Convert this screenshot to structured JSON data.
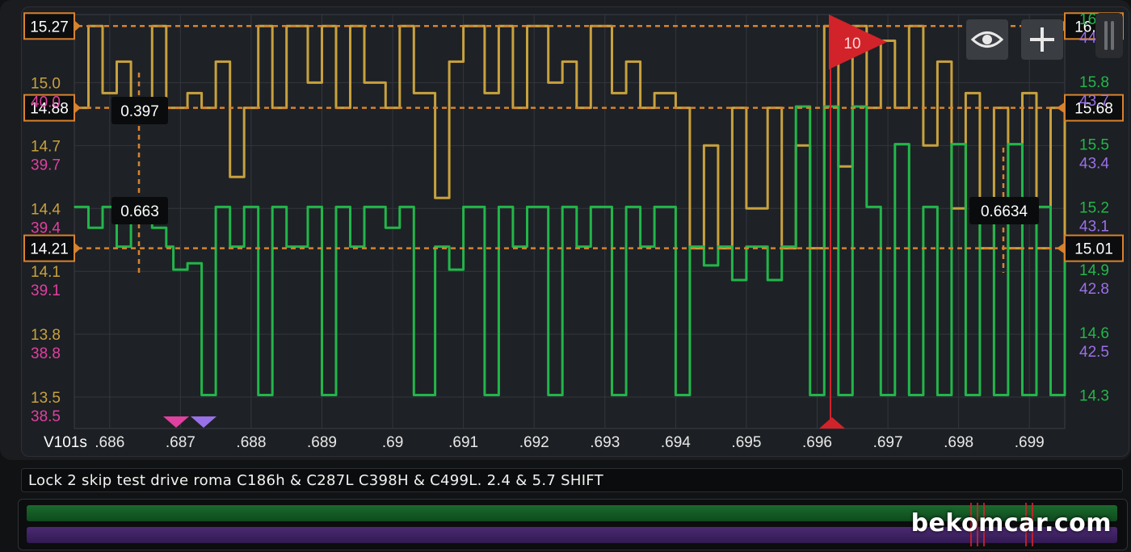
{
  "ranges": {
    "left_primary": {
      "min": 13.35,
      "max": 15.325
    },
    "right_primary": {
      "min": 14.14,
      "max": 16.12
    }
  },
  "left_axis": {
    "gold_ticks": [
      "15.0",
      "14.7",
      "14.4",
      "14.1",
      "13.8",
      "13.5"
    ],
    "pink_ticks": [
      "40.0",
      "39.7",
      "39.4",
      "39.1",
      "38.8",
      "38.5"
    ]
  },
  "right_axis": {
    "green_ticks": [
      "16.1",
      "15.8",
      "15.5",
      "15.2",
      "14.9",
      "14.6",
      "14.3"
    ],
    "purple_ticks": [
      "44.0",
      "43.7",
      "43.4",
      "43.1",
      "42.8",
      "42.5"
    ]
  },
  "x_axis": {
    "label": "V101s",
    "ticks": [
      ".686",
      ".687",
      ".688",
      ".689",
      ".69",
      ".691",
      ".692",
      ".693",
      ".694",
      ".695",
      ".696",
      ".697",
      ".698",
      ".699"
    ]
  },
  "cursor_lines": {
    "left": [
      "15.27",
      "14.88",
      "14.21"
    ],
    "right": [
      "16.07",
      "15.68",
      "15.01"
    ]
  },
  "value_labels": [
    "0.397",
    "0.663",
    "0.6634"
  ],
  "flag": {
    "label": "10"
  },
  "caption": "Lock 2 skip test drive roma C186h & C287L C398H & C499L.  2.4 & 5.7 SHIFT",
  "watermark": "bekomcar.com",
  "tools": {
    "eye_icon": "eye-icon",
    "plus_icon": "plus-icon"
  },
  "colors": {
    "gold": "#c8a13e",
    "green": "#22b64a",
    "pink": "#e040a0",
    "purple": "#9a70e8",
    "cursor": "#d8822e",
    "flag": "#d2232a"
  },
  "chart_data": {
    "type": "line",
    "x_range": [
      0.6855,
      0.6995
    ],
    "series": [
      {
        "color": "gold",
        "x": [
          0.6855,
          0.6857,
          0.6859,
          0.6861,
          0.6863,
          0.6866,
          0.6868,
          0.6871,
          0.6873,
          0.6875,
          0.6877,
          0.6879,
          0.6881,
          0.6883,
          0.6885,
          0.6888,
          0.689,
          0.6892,
          0.6894,
          0.6896,
          0.6899,
          0.6901,
          0.6903,
          0.6906,
          0.6908,
          0.691,
          0.6913,
          0.6915,
          0.6917,
          0.6919,
          0.6922,
          0.6924,
          0.6926,
          0.6928,
          0.6931,
          0.6933,
          0.6935,
          0.6937,
          0.694,
          0.6942,
          0.6944,
          0.6946,
          0.6948,
          0.695,
          0.6953,
          0.6955,
          0.6957,
          0.6959,
          0.6961,
          0.6963,
          0.6965,
          0.6967,
          0.6969,
          0.6971,
          0.6973,
          0.6975,
          0.6977,
          0.6979,
          0.6981,
          0.6983,
          0.6985,
          0.6987,
          0.6989,
          0.6991,
          0.6993,
          0.6995
        ],
        "values": [
          14.88,
          15.27,
          14.95,
          15.1,
          14.88,
          15.27,
          14.88,
          14.95,
          14.88,
          15.1,
          14.55,
          14.88,
          15.27,
          14.88,
          15.27,
          15.0,
          15.27,
          14.88,
          15.27,
          15.0,
          14.88,
          15.27,
          14.95,
          14.45,
          15.1,
          15.27,
          14.95,
          15.27,
          14.88,
          15.27,
          15.0,
          15.1,
          14.88,
          15.27,
          14.95,
          15.1,
          14.88,
          14.95,
          14.88,
          14.21,
          14.7,
          14.21,
          14.88,
          14.4,
          14.88,
          14.21,
          14.7,
          14.21,
          15.27,
          14.6,
          15.27,
          14.88,
          15.2,
          14.88,
          15.27,
          14.7,
          15.1,
          14.4,
          14.95,
          14.21,
          14.88,
          14.21,
          14.95,
          14.21,
          14.88,
          14.21
        ]
      },
      {
        "color": "green",
        "x": [
          0.6855,
          0.6857,
          0.6859,
          0.6861,
          0.6863,
          0.6866,
          0.6868,
          0.6869,
          0.6871,
          0.6873,
          0.6875,
          0.6877,
          0.6879,
          0.6881,
          0.6883,
          0.6885,
          0.6888,
          0.689,
          0.6892,
          0.6894,
          0.6896,
          0.6899,
          0.6901,
          0.6903,
          0.6906,
          0.6908,
          0.691,
          0.6913,
          0.6915,
          0.6917,
          0.6919,
          0.6922,
          0.6924,
          0.6926,
          0.6928,
          0.6931,
          0.6933,
          0.6935,
          0.6937,
          0.694,
          0.6942,
          0.6944,
          0.6946,
          0.6948,
          0.695,
          0.6953,
          0.6955,
          0.6957,
          0.6959,
          0.6961,
          0.6963,
          0.6965,
          0.6967,
          0.6969,
          0.6971,
          0.6973,
          0.6975,
          0.6977,
          0.6979,
          0.6981,
          0.6983,
          0.6985,
          0.6987,
          0.6989,
          0.6991,
          0.6993,
          0.6995
        ],
        "values": [
          15.2,
          15.1,
          15.2,
          15.01,
          15.2,
          15.1,
          15.01,
          14.9,
          14.93,
          14.3,
          15.2,
          15.01,
          15.2,
          14.3,
          15.2,
          15.01,
          15.2,
          14.3,
          15.2,
          15.01,
          15.2,
          15.1,
          15.2,
          14.3,
          15.01,
          14.9,
          15.2,
          14.3,
          15.2,
          15.01,
          15.2,
          14.3,
          15.2,
          15.01,
          15.2,
          14.3,
          15.2,
          15.01,
          15.2,
          14.3,
          15.01,
          14.92,
          15.01,
          14.85,
          15.01,
          14.85,
          15.01,
          15.68,
          14.3,
          15.68,
          14.3,
          15.68,
          15.2,
          14.3,
          15.5,
          14.3,
          15.2,
          14.3,
          15.5,
          14.3,
          15.2,
          14.3,
          15.5,
          14.3,
          15.2,
          14.3,
          15.01
        ]
      }
    ]
  }
}
